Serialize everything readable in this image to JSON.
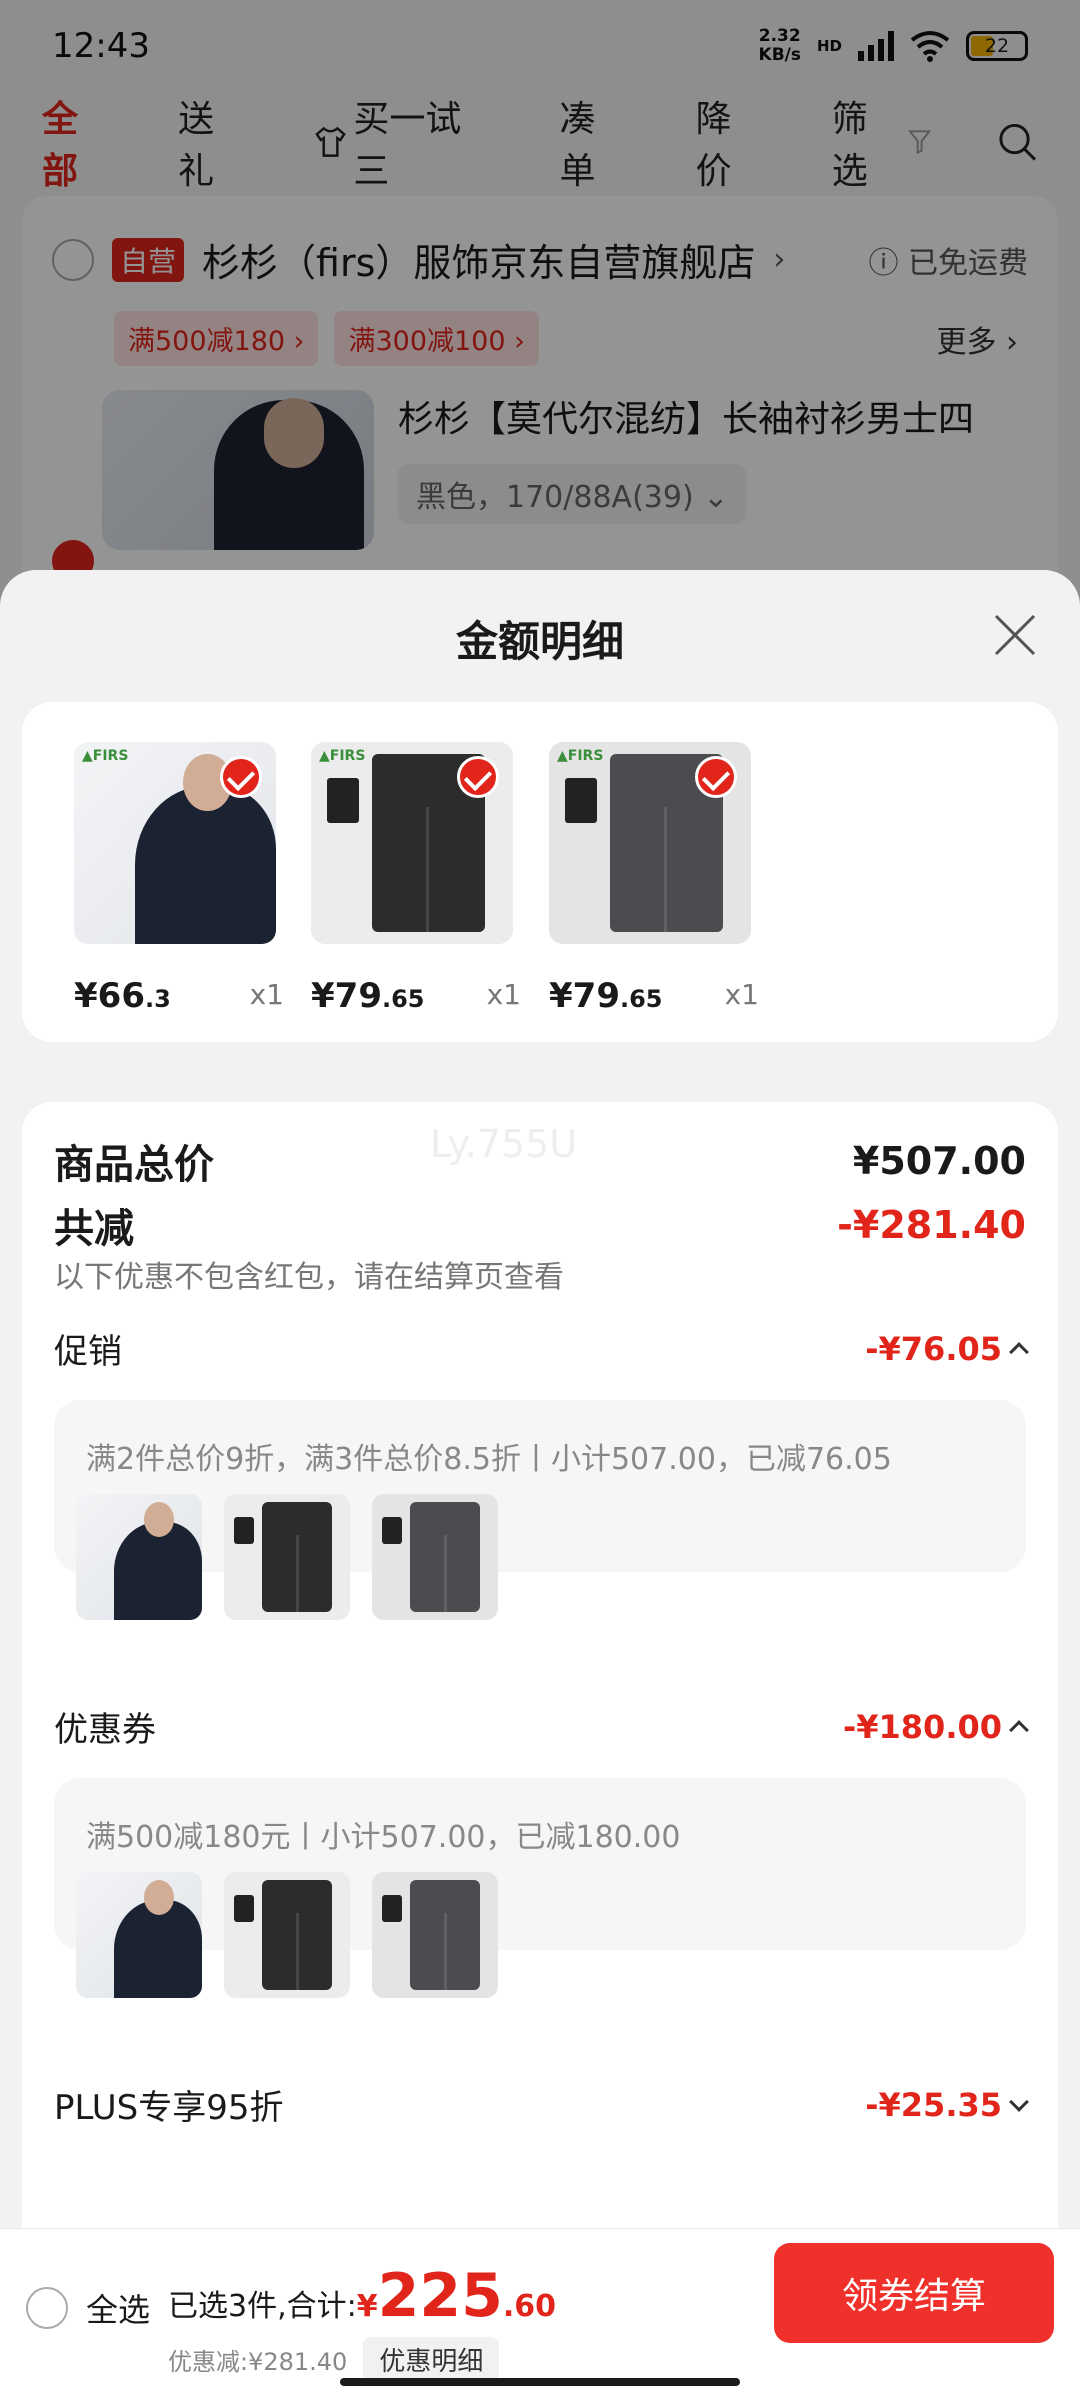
{
  "status": {
    "time": "12:43",
    "net_speed_value": "2.32",
    "net_speed_unit": "KB/s",
    "net_label": "HD",
    "battery": "22"
  },
  "filter_tabs": [
    {
      "label": "全部",
      "active": true
    },
    {
      "label": "送礼",
      "active": false
    },
    {
      "label": "买一试三",
      "active": false
    },
    {
      "label": "凑单",
      "active": false
    },
    {
      "label": "降价",
      "active": false
    },
    {
      "label": "筛选",
      "active": false
    }
  ],
  "store": {
    "badge": "自营",
    "name": "杉杉（firs）服饰京东自营旗舰店",
    "free_shipping": "已免运费",
    "coupons": [
      "满500减180",
      "满300减100"
    ],
    "more": "更多",
    "product_title": "杉杉【莫代尔混纺】长袖衬衫男士四",
    "product_spec": "黑色，170/88A(39)"
  },
  "sheet": {
    "title": "金额明细",
    "items": [
      {
        "type": "shirt",
        "price_int": "¥66",
        "price_dec": ".3",
        "qty": "x1"
      },
      {
        "type": "pants-black",
        "price_int": "¥79",
        "price_dec": ".65",
        "qty": "x1"
      },
      {
        "type": "pants-grey",
        "price_int": "¥79",
        "price_dec": ".65",
        "qty": "x1"
      }
    ],
    "watermark": "Ly.755U",
    "total_label": "商品总价",
    "total_value": "¥507.00",
    "reduce_label": "共减",
    "reduce_value": "-¥281.40",
    "reduce_note": "以下优惠不包含红包，请在结算页查看",
    "promo_label": "促销",
    "promo_value": "-¥76.05",
    "promo_desc": "满2件总价9折，满3件总价8.5折丨小计507.00，已减76.05",
    "coupon_label": "优惠券",
    "coupon_value": "-¥180.00",
    "coupon_desc": "满500减180元丨小计507.00，已减180.00",
    "plus_label": "PLUS专享95折",
    "plus_value": "-¥25.35"
  },
  "bottom": {
    "select_all": "全选",
    "selected_text": "已选3件,合计:",
    "currency": "¥",
    "total_int": "225",
    "total_dec": ".60",
    "discount_text": "优惠减:¥281.40",
    "detail_button": "优惠明细",
    "checkout_button": "领券结算"
  },
  "colors": {
    "accent": "#e1251b",
    "checkout": "#f0302a"
  }
}
